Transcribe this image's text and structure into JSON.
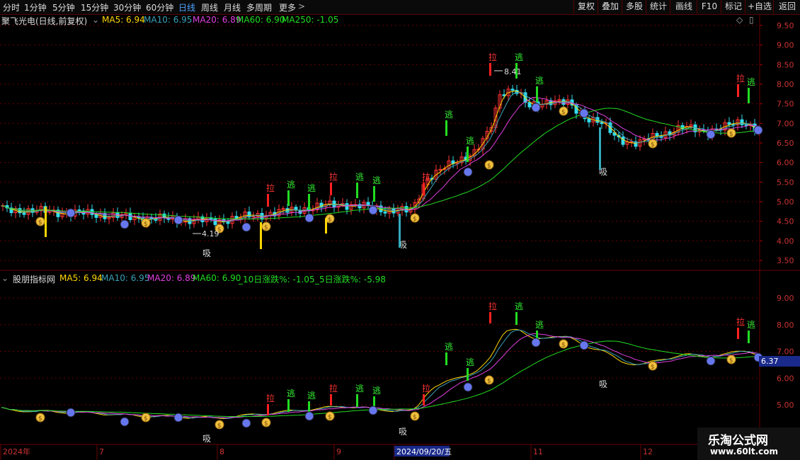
{
  "toolbar": {
    "periods": [
      "分时",
      "1分钟",
      "5分钟",
      "15分钟",
      "30分钟",
      "60分钟",
      "日线",
      "周线",
      "月线",
      "多周期",
      "更多"
    ],
    "more_arrow": ">",
    "active_period": "日线",
    "right_buttons": [
      "复权",
      "叠加",
      "多股",
      "统计",
      "画线",
      "F10",
      "标记",
      "+自选",
      "返回"
    ]
  },
  "upper": {
    "stock_title": "聚飞光电(日线,前复权)",
    "legend": [
      {
        "label": "MA5: 6.94",
        "color": "#ffd700"
      },
      {
        "label": "MA10: 6.95",
        "color": "#3aa0b8"
      },
      {
        "label": "MA20: 6.89",
        "color": "#e040e0"
      },
      {
        "label": "MA60: 6.90",
        "color": "#22dd22"
      },
      {
        "label": "MA250: -1.05",
        "color": "#22dd22"
      }
    ],
    "y_ticks": [
      "9.50",
      "9.00",
      "8.50",
      "8.00",
      "7.50",
      "7.00",
      "6.50",
      "6.00",
      "5.50",
      "5.00",
      "4.50",
      "4.00",
      "3.50"
    ],
    "annotation_high": "8.41",
    "annotation_low": "4.19"
  },
  "lower": {
    "indicator_title": "股朋指标网",
    "legend": [
      {
        "label": "MA5: 6.94",
        "color": "#ffd700"
      },
      {
        "label": "MA10: 6.95",
        "color": "#3aa0b8"
      },
      {
        "label": "MA20: 6.89",
        "color": "#e040e0"
      },
      {
        "label": "MA60: 6.90",
        "color": "#22dd22"
      },
      {
        "label": "_10日涨跌%: -1.05",
        "color": "#22dd22"
      },
      {
        "label": "_5日涨跌%: -5.98",
        "color": "#22dd22"
      }
    ],
    "y_ticks": [
      "9.00",
      "8.00",
      "7.00",
      "6.00",
      "5.00"
    ],
    "current_price": "6.37"
  },
  "signals": {
    "pull": "拉",
    "escape": "逃",
    "absorb": "吸",
    "money": "$"
  },
  "x_axis": {
    "labels": [
      "2024年",
      "7",
      "8",
      "9",
      "2024/09/20/五",
      "11",
      "12"
    ]
  },
  "colors": {
    "up": "#ff3333",
    "down": "#33ddee",
    "ma5": "#ffd700",
    "ma10": "#3aa0b8",
    "ma20": "#e040e0",
    "ma60": "#22dd22",
    "grid": "#6a0000"
  },
  "watermark": {
    "line1": "乐淘公式网",
    "line2": "www.60lt.com"
  }
}
